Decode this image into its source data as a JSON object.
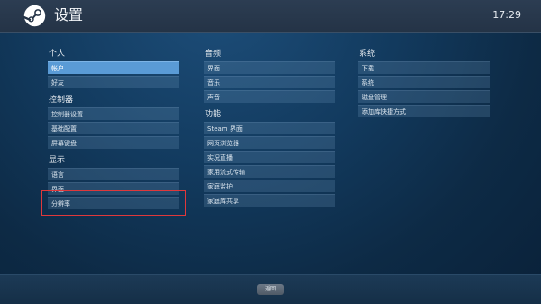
{
  "header": {
    "title": "设置",
    "time": "17:29",
    "logo_icon": "steam-logo-icon"
  },
  "columns": [
    {
      "sections": [
        {
          "title": "个人",
          "items": [
            {
              "label": "帐户",
              "selected": true
            },
            {
              "label": "好友"
            }
          ]
        },
        {
          "title": "控制器",
          "items": [
            {
              "label": "控制器设置"
            },
            {
              "label": "基础配置"
            },
            {
              "label": "屏幕键盘"
            }
          ]
        },
        {
          "title": "显示",
          "items": [
            {
              "label": "语言"
            },
            {
              "label": "界面"
            },
            {
              "label": "分辨率",
              "highlighted": true
            }
          ]
        }
      ]
    },
    {
      "sections": [
        {
          "title": "音频",
          "items": [
            {
              "label": "界面"
            },
            {
              "label": "音乐"
            },
            {
              "label": "声音"
            }
          ]
        },
        {
          "title": "功能",
          "items": [
            {
              "label": "Steam 界面"
            },
            {
              "label": "网页浏览器"
            },
            {
              "label": "实况直播"
            },
            {
              "label": "家用流式传输"
            },
            {
              "label": "家庭监护"
            },
            {
              "label": "家庭库共享"
            }
          ]
        }
      ]
    },
    {
      "sections": [
        {
          "title": "系统",
          "items": [
            {
              "label": "下载"
            },
            {
              "label": "系统"
            },
            {
              "label": "磁盘管理"
            },
            {
              "label": "添加库快捷方式"
            }
          ]
        }
      ]
    }
  ],
  "footer": {
    "back_label": "返回"
  },
  "colors": {
    "accent": "#5a9bd6",
    "highlight_box": "#e0383b"
  }
}
